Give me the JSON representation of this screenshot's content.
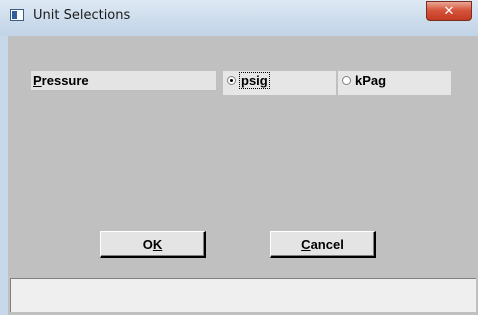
{
  "window": {
    "title": "Unit Selections",
    "close_symbol": "✕"
  },
  "form": {
    "pressure_label": "Pressure",
    "pressure_label_mnemonic": "P",
    "pressure_label_rest": "ressure",
    "options": [
      {
        "label": "psig",
        "selected": true
      },
      {
        "label": "kPag",
        "selected": false
      }
    ]
  },
  "buttons": {
    "ok_label": "OK",
    "ok_prefix": "O",
    "ok_mnemonic": "K",
    "cancel_label": "Cancel",
    "cancel_mnemonic": "C",
    "cancel_rest": "ancel"
  },
  "status": {
    "text": ""
  },
  "colors": {
    "client_bg": "#c0c0c0",
    "close_button": "#c23a22",
    "titlebar": "#cddcec"
  },
  "icons": [
    "app-window-icon",
    "close-icon",
    "radio-button-icon"
  ]
}
